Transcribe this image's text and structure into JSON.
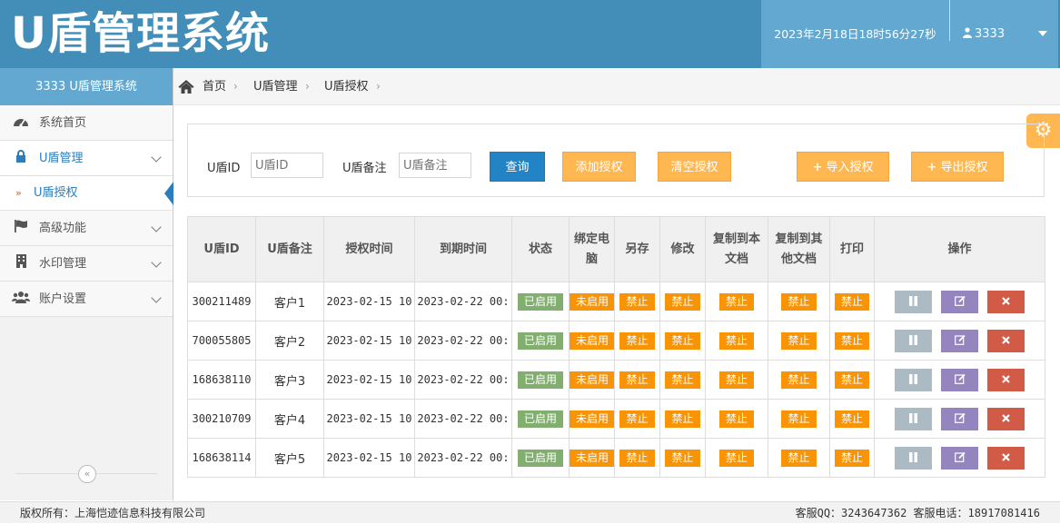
{
  "header": {
    "logo": "U盾管理系统",
    "datetime": "2023年2月18日18时56分27秒",
    "username": "3333",
    "user_icon": "user-icon",
    "dropdown_icon": "caret-down-icon"
  },
  "sidebar": {
    "title": "3333 U盾管理系统",
    "items": [
      {
        "label": "系统首页",
        "icon": "dashboard-icon"
      },
      {
        "label": "U盾管理",
        "icon": "lock-icon"
      },
      {
        "label": "U盾授权",
        "icon": "double-chevron-right-icon"
      },
      {
        "label": "高级功能",
        "icon": "flag-icon"
      },
      {
        "label": "水印管理",
        "icon": "building-icon"
      },
      {
        "label": "账户设置",
        "icon": "users-icon"
      }
    ],
    "collapse_icon": "double-chevron-left-icon"
  },
  "breadcrumb": {
    "home_icon": "home-icon",
    "items": [
      "首页",
      "U盾管理",
      "U盾授权"
    ]
  },
  "settings_icon": "gear-icon",
  "search": {
    "id_label": "U盾ID",
    "id_placeholder": "U盾ID",
    "note_label": "U盾备注",
    "note_placeholder": "U盾备注",
    "query_button": "查询",
    "add_button": "添加授权",
    "clear_button": "清空授权",
    "import_button": "导入授权",
    "export_button": "导出授权",
    "plus_glyph": "+"
  },
  "table": {
    "headers": [
      "U盾ID",
      "U盾备注",
      "授权时间",
      "到期时间",
      "状态",
      "绑定电脑",
      "另存",
      "修改",
      "复制到本文档",
      "复制到其他文档",
      "打印",
      "操作"
    ],
    "rows": [
      {
        "id": "300211489",
        "note": "客户1",
        "auth_time": "2023-02-15 10",
        "expire_time": "2023-02-22 00:",
        "status": "已启用",
        "bind": "未启用",
        "save_as": "禁止",
        "modify": "禁止",
        "copy_this": "禁止",
        "copy_other": "禁止",
        "print": "禁止"
      },
      {
        "id": "700055805",
        "note": "客户2",
        "auth_time": "2023-02-15 10",
        "expire_time": "2023-02-22 00:",
        "status": "已启用",
        "bind": "未启用",
        "save_as": "禁止",
        "modify": "禁止",
        "copy_this": "禁止",
        "copy_other": "禁止",
        "print": "禁止"
      },
      {
        "id": "168638110",
        "note": "客户3",
        "auth_time": "2023-02-15 10",
        "expire_time": "2023-02-22 00:",
        "status": "已启用",
        "bind": "未启用",
        "save_as": "禁止",
        "modify": "禁止",
        "copy_this": "禁止",
        "copy_other": "禁止",
        "print": "禁止"
      },
      {
        "id": "300210709",
        "note": "客户4",
        "auth_time": "2023-02-15 10",
        "expire_time": "2023-02-22 00:",
        "status": "已启用",
        "bind": "未启用",
        "save_as": "禁止",
        "modify": "禁止",
        "copy_this": "禁止",
        "copy_other": "禁止",
        "print": "禁止"
      },
      {
        "id": "168638114",
        "note": "客户5",
        "auth_time": "2023-02-15 10",
        "expire_time": "2023-02-22 00:",
        "status": "已启用",
        "bind": "未启用",
        "save_as": "禁止",
        "modify": "禁止",
        "copy_this": "禁止",
        "copy_other": "禁止",
        "print": "禁止"
      }
    ],
    "action_icons": [
      "pause-icon",
      "edit-icon",
      "delete-icon"
    ],
    "colors": {
      "enabled": "#82af6f",
      "forbidden": "#f89406",
      "pause": "#abbac3",
      "edit": "#9585bf",
      "delete": "#d15b47"
    }
  },
  "footer": {
    "copyright": "版权所有：上海恺迹信息科技有限公司",
    "contact": "客服QQ：3243647362 客服电话：18917081416"
  },
  "colors": {
    "header": "#438eb9",
    "header_light": "#62a8d1",
    "orange_button": "#ffb752",
    "blue_button": "#2283c5"
  }
}
